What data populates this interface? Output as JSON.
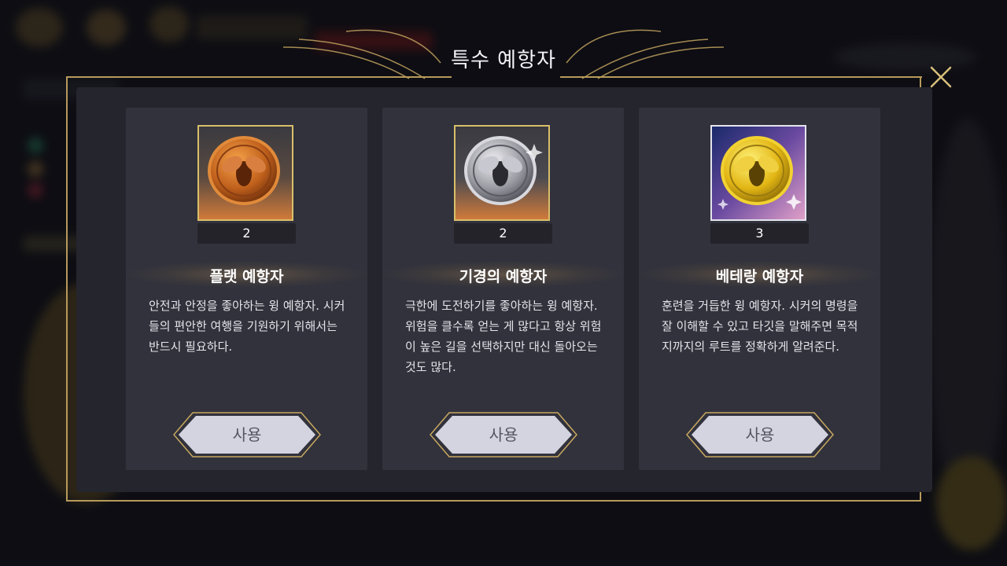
{
  "dialog": {
    "title": "특수 예항자"
  },
  "cards": [
    {
      "count": "2",
      "name": "플랫 예항자",
      "description": "안전과 안정을 좋아하는 윙 예항자. 시커들의 편안한 여행을 기원하기 위해서는 반드시 필요하다.",
      "button_label": "사용",
      "icon": "bronze-bee-coin-icon"
    },
    {
      "count": "2",
      "name": "기경의 예항자",
      "description": "극한에 도전하기를 좋아하는 윙 예항자. 위험을 클수록 얻는 게 많다고 항상 위험이 높은 길을 선택하지만 대신 돌아오는 것도 많다.",
      "button_label": "사용",
      "icon": "silver-bee-coin-icon"
    },
    {
      "count": "3",
      "name": "베테랑 예항자",
      "description": "훈련을 거듭한 윙 예항자. 시커의 명령을 잘 이해할 수 있고 타깃을 말해주면 목적지까지의 루트를 정확하게 알려준다.",
      "button_label": "사용",
      "icon": "gold-bee-coin-icon"
    }
  ],
  "colors": {
    "frame_gold": "#b79a5a",
    "card_bg": "#31323c",
    "panel_bg": "#25252e"
  }
}
